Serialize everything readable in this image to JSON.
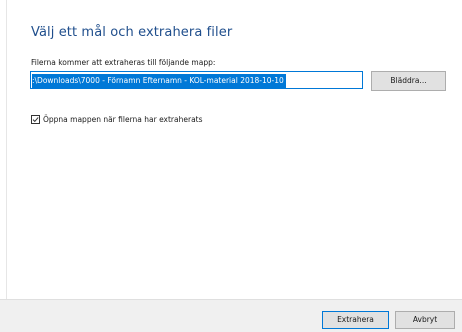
{
  "dialog": {
    "heading": "Välj ett mål och extrahera filer",
    "field_label": "Filerna kommer att extraheras till följande mapp:",
    "path_value": ":\\Downloads\\7000 - Förnamn Efternamn - KOL-material 2018-10-10",
    "browse_label": "Bläddra...",
    "checkbox": {
      "label": "Öppna mappen när filerna har extraherats",
      "checked": true
    }
  },
  "footer": {
    "extract_label": "Extrahera",
    "cancel_label": "Avbryt"
  },
  "colors": {
    "heading": "#1f4e8c",
    "accent": "#0078d7",
    "footer_bg": "#f0f0f0",
    "button_bg": "#e1e1e1"
  },
  "icons": {
    "checkbox_mark": "checkmark-icon"
  }
}
